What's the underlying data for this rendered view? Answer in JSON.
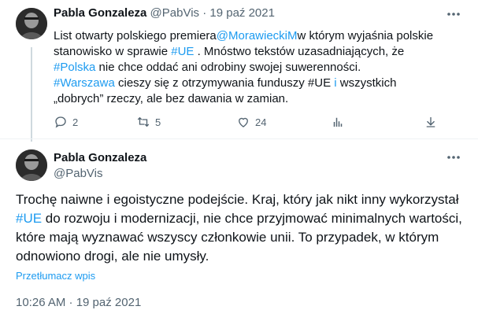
{
  "tweet1": {
    "name": "Pabla Gonzaleza",
    "handle": "@PabVis",
    "dot": "·",
    "date": "19 paź 2021",
    "text": {
      "p1": "List otwarty polskiego premiera",
      "mention": "@MorawieckiM",
      "p2": "w którym wyjaśnia polskie stanowisko w sprawie ",
      "tag_ue1": "#UE",
      "p3": " . Mnóstwo tekstów uzasadniających, że ",
      "tag_polska": "#Polska",
      "p4": " nie chce oddać ani odrobiny swojej suwerenności.",
      "p5": " ",
      "tag_warszawa": "#Warszawa",
      "p6": " cieszy się z otrzymywania funduszy #UE ",
      "link_i": "i",
      "p7": " wszystkich „dobrych” rzeczy, ale bez dawania w zamian."
    },
    "actions": {
      "replies": "2",
      "retweets": "5",
      "likes": "24"
    }
  },
  "tweet2": {
    "name": "Pabla Gonzaleza",
    "handle": "@PabVis",
    "text": {
      "p1": "Trochę naiwne i egoistyczne podejście. Kraj, który jak nikt inny wykorzystał ",
      "tag_ue": "#UE",
      "p2": " do rozwoju i modernizacji, nie chce przyjmować minimalnych wartości, które mają wyznawać wszyscy członkowie unii. To przypadek, w którym odnowiono drogi, ale nie umysły."
    },
    "translate": "Przetłumacz wpis",
    "timestamp": "10:26 AM · 19 paź 2021"
  },
  "colors": {
    "link": "#1d9bf0",
    "muted": "#536471",
    "text": "#0f1419"
  },
  "icons": [
    "avatar",
    "more-icon",
    "reply-icon",
    "retweet-icon",
    "like-icon",
    "views-icon",
    "bookmark-icon"
  ]
}
